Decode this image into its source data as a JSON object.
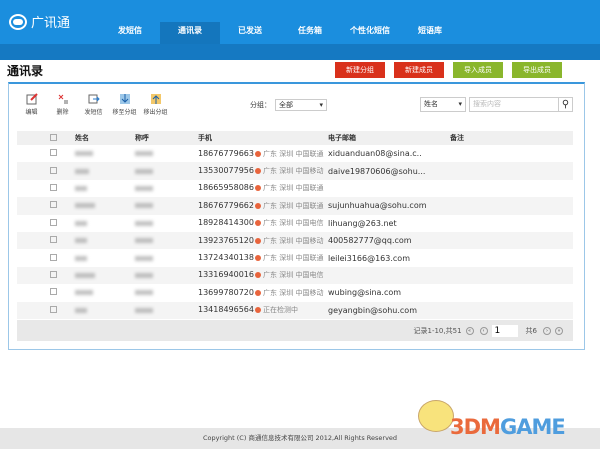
{
  "app": {
    "name": "广讯通"
  },
  "nav": [
    "发短信",
    "通讯录",
    "已发送",
    "任务箱",
    "个性化短信",
    "短语库"
  ],
  "nav_active": 1,
  "page_title": "通讯录",
  "actions": [
    "新建分组",
    "新建成员",
    "导入成员",
    "导出成员"
  ],
  "toolbar": [
    "编辑",
    "删除",
    "发短信",
    "移至分组",
    "移出分组"
  ],
  "group": {
    "label": "分组：",
    "value": "全部"
  },
  "search": {
    "field": "姓名",
    "placeholder": "搜索内容"
  },
  "columns": [
    "姓名",
    "称呼",
    "手机",
    "电子邮箱",
    "备注"
  ],
  "rows": [
    {
      "phone": "18676779663",
      "loc": "广东 深圳 中国联通",
      "email": "xiduanduan08@sina.c.."
    },
    {
      "phone": "13530077956",
      "loc": "广东 深圳 中国移动",
      "email": "daive19870606@sohu..."
    },
    {
      "phone": "18665958086",
      "loc": "广东 深圳 中国联通",
      "email": ""
    },
    {
      "phone": "18676779662",
      "loc": "广东 深圳 中国联通",
      "email": "sujunhuahua@sohu.com"
    },
    {
      "phone": "18928414300",
      "loc": "广东 深圳 中国电信",
      "email": "lihuang@263.net"
    },
    {
      "phone": "13923765120",
      "loc": "广东 深圳 中国移动",
      "email": "400582777@qq.com"
    },
    {
      "phone": "13724340138",
      "loc": "广东 深圳 中国联通",
      "email": "leilei3166@163.com"
    },
    {
      "phone": "13316940016",
      "loc": "广东 深圳 中国电信",
      "email": ""
    },
    {
      "phone": "13699780720",
      "loc": "广东 深圳 中国移动",
      "email": "wubing@sina.com"
    },
    {
      "phone": "13418496564",
      "loc": "正在检测中",
      "email": "geyangbin@sohu.com"
    }
  ],
  "pager": {
    "records": "记录1-10,共51",
    "page": "1",
    "total": "共6"
  },
  "footer": "Copyright (C) 商通信息技术有限公司 2012,All Rights Reserved",
  "watermark": {
    "a": "3DM",
    "b": "GAME"
  }
}
